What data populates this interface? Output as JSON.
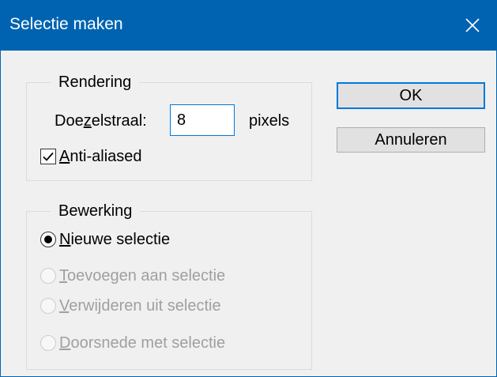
{
  "window": {
    "title": "Selectie maken"
  },
  "rendering": {
    "legend": "Rendering",
    "feather": {
      "label": "Doezelstraal:",
      "value": "8",
      "unit": "pixels"
    },
    "anti_aliased": {
      "label": "Anti-aliased",
      "checked": true
    }
  },
  "operation": {
    "legend": "Bewerking",
    "options": [
      {
        "label": "Nieuwe selectie",
        "selected": true,
        "enabled": true
      },
      {
        "label": "Toevoegen aan selectie",
        "selected": false,
        "enabled": false
      },
      {
        "label": "Verwijderen uit selectie",
        "selected": false,
        "enabled": false
      },
      {
        "label": "Doorsnede met selectie",
        "selected": false,
        "enabled": false
      }
    ]
  },
  "buttons": {
    "ok": "OK",
    "cancel": "Annuleren"
  },
  "colors": {
    "titlebar": "#0063b1",
    "focus": "#0078d7",
    "dialog_bg": "#f0f0f0",
    "disabled_text": "#a0a0a0"
  },
  "icons": {
    "close": "close-icon",
    "check": "checkmark-icon"
  }
}
